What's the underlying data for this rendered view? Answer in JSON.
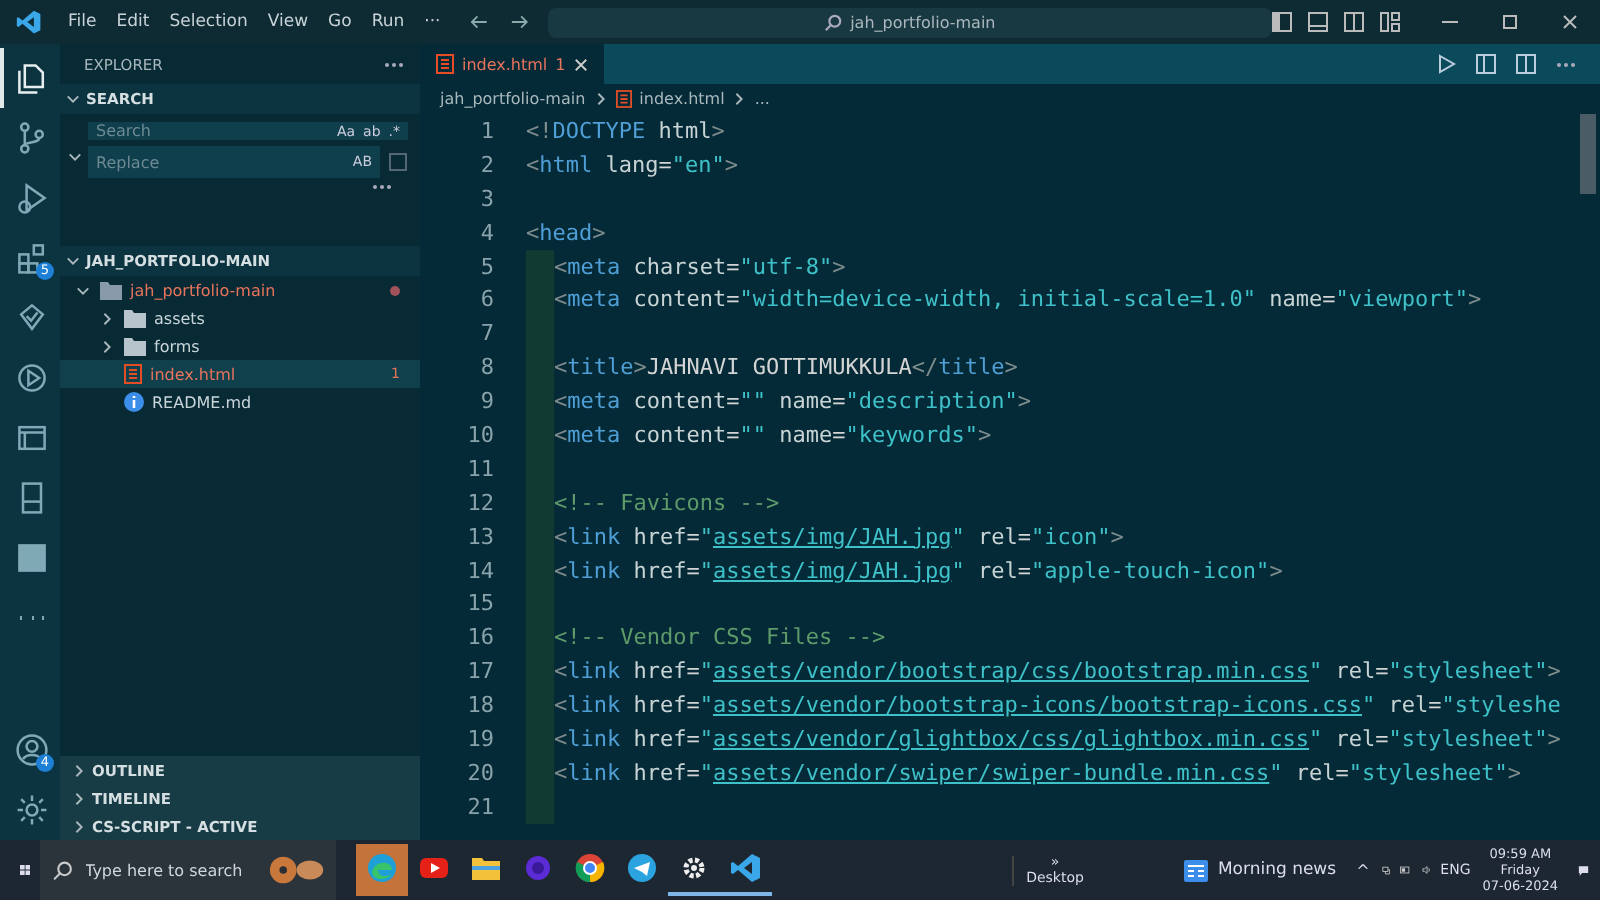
{
  "title_bar": {
    "menu": [
      "File",
      "Edit",
      "Selection",
      "View",
      "Go",
      "Run",
      "···"
    ],
    "command_center": "jah_portfolio-main"
  },
  "activity_bar": [
    {
      "kind": "files",
      "selected": true
    },
    {
      "kind": "source-control",
      "selected": false
    },
    {
      "kind": "run",
      "selected": false
    },
    {
      "kind": "extensions",
      "selected": false,
      "badge": "5"
    },
    {
      "kind": "testing",
      "selected": false
    },
    {
      "kind": "play",
      "selected": false
    },
    {
      "kind": "windows",
      "selected": false
    },
    {
      "kind": "device",
      "selected": false
    },
    {
      "kind": "tile",
      "selected": false
    },
    {
      "kind": "more",
      "selected": false
    },
    {
      "kind": "account",
      "selected": false,
      "badge": "4"
    },
    {
      "kind": "settings",
      "selected": false
    }
  ],
  "sidebar": {
    "title": "EXPLORER",
    "search_section": "SEARCH",
    "search": {
      "placeholder": "Search",
      "options": [
        "Aa",
        "ab",
        ".*"
      ]
    },
    "replace": {
      "placeholder": "Replace",
      "option": "AB"
    },
    "folder_section": "JAH_PORTFOLIO-MAIN",
    "tree": [
      {
        "name": "jah_portfolio-main",
        "kind": "folder",
        "expanded": true,
        "modified": true,
        "error": true,
        "selected": false,
        "children": [
          {
            "name": "assets",
            "kind": "folder",
            "expanded": false,
            "modified": false,
            "error": false,
            "selected": false
          },
          {
            "name": "forms",
            "kind": "folder",
            "expanded": false,
            "modified": false,
            "error": false,
            "selected": false
          },
          {
            "name": "index.html",
            "kind": "html",
            "modified": false,
            "error": true,
            "selected": true,
            "count": "1"
          },
          {
            "name": "README.md",
            "kind": "info",
            "modified": false,
            "error": false,
            "selected": false
          }
        ]
      }
    ],
    "bottom_sections": [
      "OUTLINE",
      "TIMELINE",
      "CS-SCRIPT - ACTIVE"
    ]
  },
  "editor": {
    "tabs": [
      {
        "label": "index.html",
        "count": "1",
        "selected": true
      }
    ],
    "breadcrumbs": [
      "jah_portfolio-main",
      "index.html",
      "..."
    ],
    "lines": [
      {
        "number": "1",
        "indent": false,
        "tokens": [
          {
            "kind": "p",
            "t": "<!"
          },
          {
            "kind": "tag",
            "t": "DOCTYPE"
          },
          {
            "kind": "attr",
            "t": " html"
          },
          {
            "kind": "p",
            "t": ">"
          }
        ]
      },
      {
        "number": "2",
        "indent": false,
        "tokens": [
          {
            "kind": "p",
            "t": "<"
          },
          {
            "kind": "tag",
            "t": "html"
          },
          {
            "kind": "attr",
            "t": " lang"
          },
          {
            "kind": "txt",
            "t": "="
          },
          {
            "kind": "str",
            "t": "\"en\""
          },
          {
            "kind": "p",
            "t": ">"
          }
        ]
      },
      {
        "number": "3",
        "indent": false
      },
      {
        "number": "4",
        "indent": false,
        "tokens": [
          {
            "kind": "p",
            "t": "<"
          },
          {
            "kind": "tag",
            "t": "head"
          },
          {
            "kind": "p",
            "t": ">"
          }
        ]
      },
      {
        "number": "5",
        "indent": true,
        "tokens": [
          {
            "kind": "p",
            "t": "<"
          },
          {
            "kind": "tag",
            "t": "meta"
          },
          {
            "kind": "attr",
            "t": " charset"
          },
          {
            "kind": "txt",
            "t": "="
          },
          {
            "kind": "str",
            "t": "\"utf-8\""
          },
          {
            "kind": "p",
            "t": ">"
          }
        ]
      },
      {
        "number": "6",
        "indent": true,
        "tokens": [
          {
            "kind": "p",
            "t": "<"
          },
          {
            "kind": "tag",
            "t": "meta"
          },
          {
            "kind": "attr",
            "t": " content"
          },
          {
            "kind": "txt",
            "t": "="
          },
          {
            "kind": "str",
            "t": "\"width=device-width, initial-scale=1.0\""
          },
          {
            "kind": "attr",
            "t": " name"
          },
          {
            "kind": "txt",
            "t": "="
          },
          {
            "kind": "str",
            "t": "\"viewport\""
          },
          {
            "kind": "p",
            "t": ">"
          }
        ]
      },
      {
        "number": "7",
        "indent": true
      },
      {
        "number": "8",
        "indent": true,
        "tokens": [
          {
            "kind": "p",
            "t": "<"
          },
          {
            "kind": "tag",
            "t": "title"
          },
          {
            "kind": "p",
            "t": ">"
          },
          {
            "kind": "txt",
            "t": "JAHNAVI GOTTIMUKKULA"
          },
          {
            "kind": "p",
            "t": "</"
          },
          {
            "kind": "tag",
            "t": "title"
          },
          {
            "kind": "p",
            "t": ">"
          }
        ]
      },
      {
        "number": "9",
        "indent": true,
        "tokens": [
          {
            "kind": "p",
            "t": "<"
          },
          {
            "kind": "tag",
            "t": "meta"
          },
          {
            "kind": "attr",
            "t": " content"
          },
          {
            "kind": "txt",
            "t": "="
          },
          {
            "kind": "str",
            "t": "\"\""
          },
          {
            "kind": "attr",
            "t": " name"
          },
          {
            "kind": "txt",
            "t": "="
          },
          {
            "kind": "str",
            "t": "\"description\""
          },
          {
            "kind": "p",
            "t": ">"
          }
        ]
      },
      {
        "number": "10",
        "indent": true,
        "tokens": [
          {
            "kind": "p",
            "t": "<"
          },
          {
            "kind": "tag",
            "t": "meta"
          },
          {
            "kind": "attr",
            "t": " content"
          },
          {
            "kind": "txt",
            "t": "="
          },
          {
            "kind": "str",
            "t": "\"\""
          },
          {
            "kind": "attr",
            "t": " name"
          },
          {
            "kind": "txt",
            "t": "="
          },
          {
            "kind": "str",
            "t": "\"keywords\""
          },
          {
            "kind": "p",
            "t": ">"
          }
        ]
      },
      {
        "number": "11",
        "indent": true
      },
      {
        "number": "12",
        "indent": true,
        "tokens": [
          {
            "kind": "com",
            "t": "<!-- Favicons -->"
          }
        ]
      },
      {
        "number": "13",
        "indent": true,
        "tokens": [
          {
            "kind": "p",
            "t": "<"
          },
          {
            "kind": "tag",
            "t": "link"
          },
          {
            "kind": "attr",
            "t": " href"
          },
          {
            "kind": "txt",
            "t": "="
          },
          {
            "kind": "str",
            "t": "\""
          },
          {
            "kind": "link",
            "t": "assets/img/JAH.jpg"
          },
          {
            "kind": "str",
            "t": "\""
          },
          {
            "kind": "attr",
            "t": " rel"
          },
          {
            "kind": "txt",
            "t": "="
          },
          {
            "kind": "str",
            "t": "\"icon\""
          },
          {
            "kind": "p",
            "t": ">"
          }
        ]
      },
      {
        "number": "14",
        "indent": true,
        "tokens": [
          {
            "kind": "p",
            "t": "<"
          },
          {
            "kind": "tag",
            "t": "link"
          },
          {
            "kind": "attr",
            "t": " href"
          },
          {
            "kind": "txt",
            "t": "="
          },
          {
            "kind": "str",
            "t": "\""
          },
          {
            "kind": "link",
            "t": "assets/img/JAH.jpg"
          },
          {
            "kind": "str",
            "t": "\""
          },
          {
            "kind": "attr",
            "t": " rel"
          },
          {
            "kind": "txt",
            "t": "="
          },
          {
            "kind": "str",
            "t": "\"apple-touch-icon\""
          },
          {
            "kind": "p",
            "t": ">"
          }
        ]
      },
      {
        "number": "15",
        "indent": true
      },
      {
        "number": "16",
        "indent": true,
        "tokens": [
          {
            "kind": "com",
            "t": "<!-- Vendor CSS Files -->"
          }
        ]
      },
      {
        "number": "17",
        "indent": true,
        "tokens": [
          {
            "kind": "p",
            "t": "<"
          },
          {
            "kind": "tag",
            "t": "link"
          },
          {
            "kind": "attr",
            "t": " href"
          },
          {
            "kind": "txt",
            "t": "="
          },
          {
            "kind": "str",
            "t": "\""
          },
          {
            "kind": "link",
            "t": "assets/vendor/bootstrap/css/bootstrap.min.css"
          },
          {
            "kind": "str",
            "t": "\""
          },
          {
            "kind": "attr",
            "t": " rel"
          },
          {
            "kind": "txt",
            "t": "="
          },
          {
            "kind": "str",
            "t": "\"stylesheet\""
          },
          {
            "kind": "p",
            "t": ">"
          }
        ]
      },
      {
        "number": "18",
        "indent": true,
        "tokens": [
          {
            "kind": "p",
            "t": "<"
          },
          {
            "kind": "tag",
            "t": "link"
          },
          {
            "kind": "attr",
            "t": " href"
          },
          {
            "kind": "txt",
            "t": "="
          },
          {
            "kind": "str",
            "t": "\""
          },
          {
            "kind": "link",
            "t": "assets/vendor/bootstrap-icons/bootstrap-icons.css"
          },
          {
            "kind": "str",
            "t": "\""
          },
          {
            "kind": "attr",
            "t": " rel"
          },
          {
            "kind": "txt",
            "t": "="
          },
          {
            "kind": "str",
            "t": "\"styleshe"
          }
        ]
      },
      {
        "number": "19",
        "indent": true,
        "tokens": [
          {
            "kind": "p",
            "t": "<"
          },
          {
            "kind": "tag",
            "t": "link"
          },
          {
            "kind": "attr",
            "t": " href"
          },
          {
            "kind": "txt",
            "t": "="
          },
          {
            "kind": "str",
            "t": "\""
          },
          {
            "kind": "link",
            "t": "assets/vendor/glightbox/css/glightbox.min.css"
          },
          {
            "kind": "str",
            "t": "\""
          },
          {
            "kind": "attr",
            "t": " rel"
          },
          {
            "kind": "txt",
            "t": "="
          },
          {
            "kind": "str",
            "t": "\"stylesheet\""
          },
          {
            "kind": "p",
            "t": ">"
          }
        ]
      },
      {
        "number": "20",
        "indent": true,
        "tokens": [
          {
            "kind": "p",
            "t": "<"
          },
          {
            "kind": "tag",
            "t": "link"
          },
          {
            "kind": "attr",
            "t": " href"
          },
          {
            "kind": "txt",
            "t": "="
          },
          {
            "kind": "str",
            "t": "\""
          },
          {
            "kind": "link",
            "t": "assets/vendor/swiper/swiper-bundle.min.css"
          },
          {
            "kind": "str",
            "t": "\""
          },
          {
            "kind": "attr",
            "t": " rel"
          },
          {
            "kind": "txt",
            "t": "="
          },
          {
            "kind": "str",
            "t": "\"stylesheet\""
          },
          {
            "kind": "p",
            "t": ">"
          }
        ]
      },
      {
        "number": "21",
        "indent": true
      }
    ]
  },
  "taskbar": {
    "search_placeholder": "Type here to search",
    "apps": [
      {
        "kind": "edge",
        "selected": true,
        "running": false
      },
      {
        "kind": "youtube",
        "selected": false,
        "running": false
      },
      {
        "kind": "files",
        "selected": false,
        "running": false
      },
      {
        "kind": "ring",
        "selected": false,
        "running": false
      },
      {
        "kind": "chrome",
        "selected": false,
        "running": false
      },
      {
        "kind": "telegram",
        "selected": false,
        "running": false
      },
      {
        "kind": "settings",
        "selected": false,
        "running": true
      },
      {
        "kind": "vscode",
        "selected": false,
        "running": true
      }
    ],
    "desktop_label": "Desktop",
    "desktop_chevron": "»",
    "news": "Morning news",
    "tray_chevron": "^",
    "language": "ENG",
    "time": "09:59 AM",
    "day": "Friday",
    "date": "07-06-2024"
  }
}
